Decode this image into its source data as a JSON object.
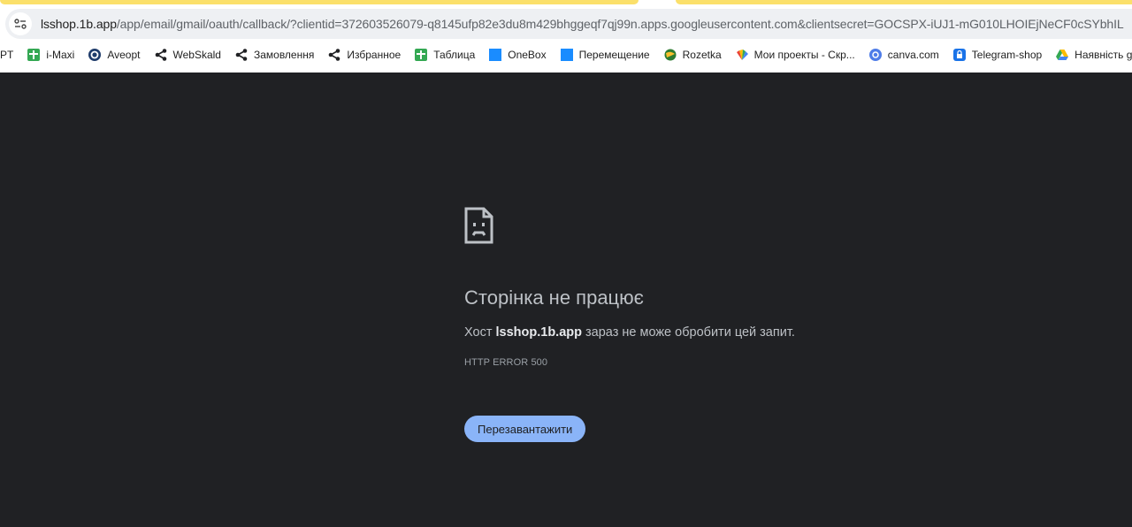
{
  "address_bar": {
    "host": "lsshop.1b.app",
    "path": "/app/email/gmail/oauth/callback/?clientid=372603526079-q8145ufp82e3du8m429bhggeqf7qj99n.apps.googleusercontent.com&clientsecret=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",
    "icon": "site-info-icon"
  },
  "bookmarks": [
    {
      "label": "PT",
      "icon": "none"
    },
    {
      "label": "i-Maxi",
      "icon": "sheets-plus-icon",
      "color": "#34a853"
    },
    {
      "label": "Aveopt",
      "icon": "target-icon",
      "color": "#1f3c6b"
    },
    {
      "label": "WebSkald",
      "icon": "share-icon",
      "color": "#202124"
    },
    {
      "label": "Замовлення",
      "icon": "share-icon",
      "color": "#202124"
    },
    {
      "label": "Избранное",
      "icon": "share-icon",
      "color": "#202124"
    },
    {
      "label": "Таблица",
      "icon": "sheets-plus-icon",
      "color": "#34a853"
    },
    {
      "label": "OneBox",
      "icon": "square-icon",
      "color": "#1a8cff"
    },
    {
      "label": "Перемещение",
      "icon": "square-icon",
      "color": "#1a8cff"
    },
    {
      "label": "Rozetka",
      "icon": "globe-icon",
      "color": "#2e7d32"
    },
    {
      "label": "Мои проекты - Скр...",
      "icon": "colorful-fan-icon",
      "color": "#f4b400"
    },
    {
      "label": "canva.com",
      "icon": "canva-icon",
      "color": "#4e7ce8"
    },
    {
      "label": "Telegram-shop",
      "icon": "lock-icon",
      "color": "#1a73e8"
    },
    {
      "label": "Наявність glassWS",
      "icon": "drive-icon",
      "color": "#fbbc04"
    }
  ],
  "error": {
    "icon": "sad-page-icon",
    "title": "Сторінка не працює",
    "desc_prefix": "Хост ",
    "desc_host": "lsshop.1b.app",
    "desc_suffix": " зараз не може обробити цей запит.",
    "code": "HTTP ERROR 500",
    "reload_label": "Перезавантажити"
  },
  "colors": {
    "page_bg": "#202124",
    "button_bg": "#8ab4f8",
    "tab_accent": "#fbe06b"
  }
}
